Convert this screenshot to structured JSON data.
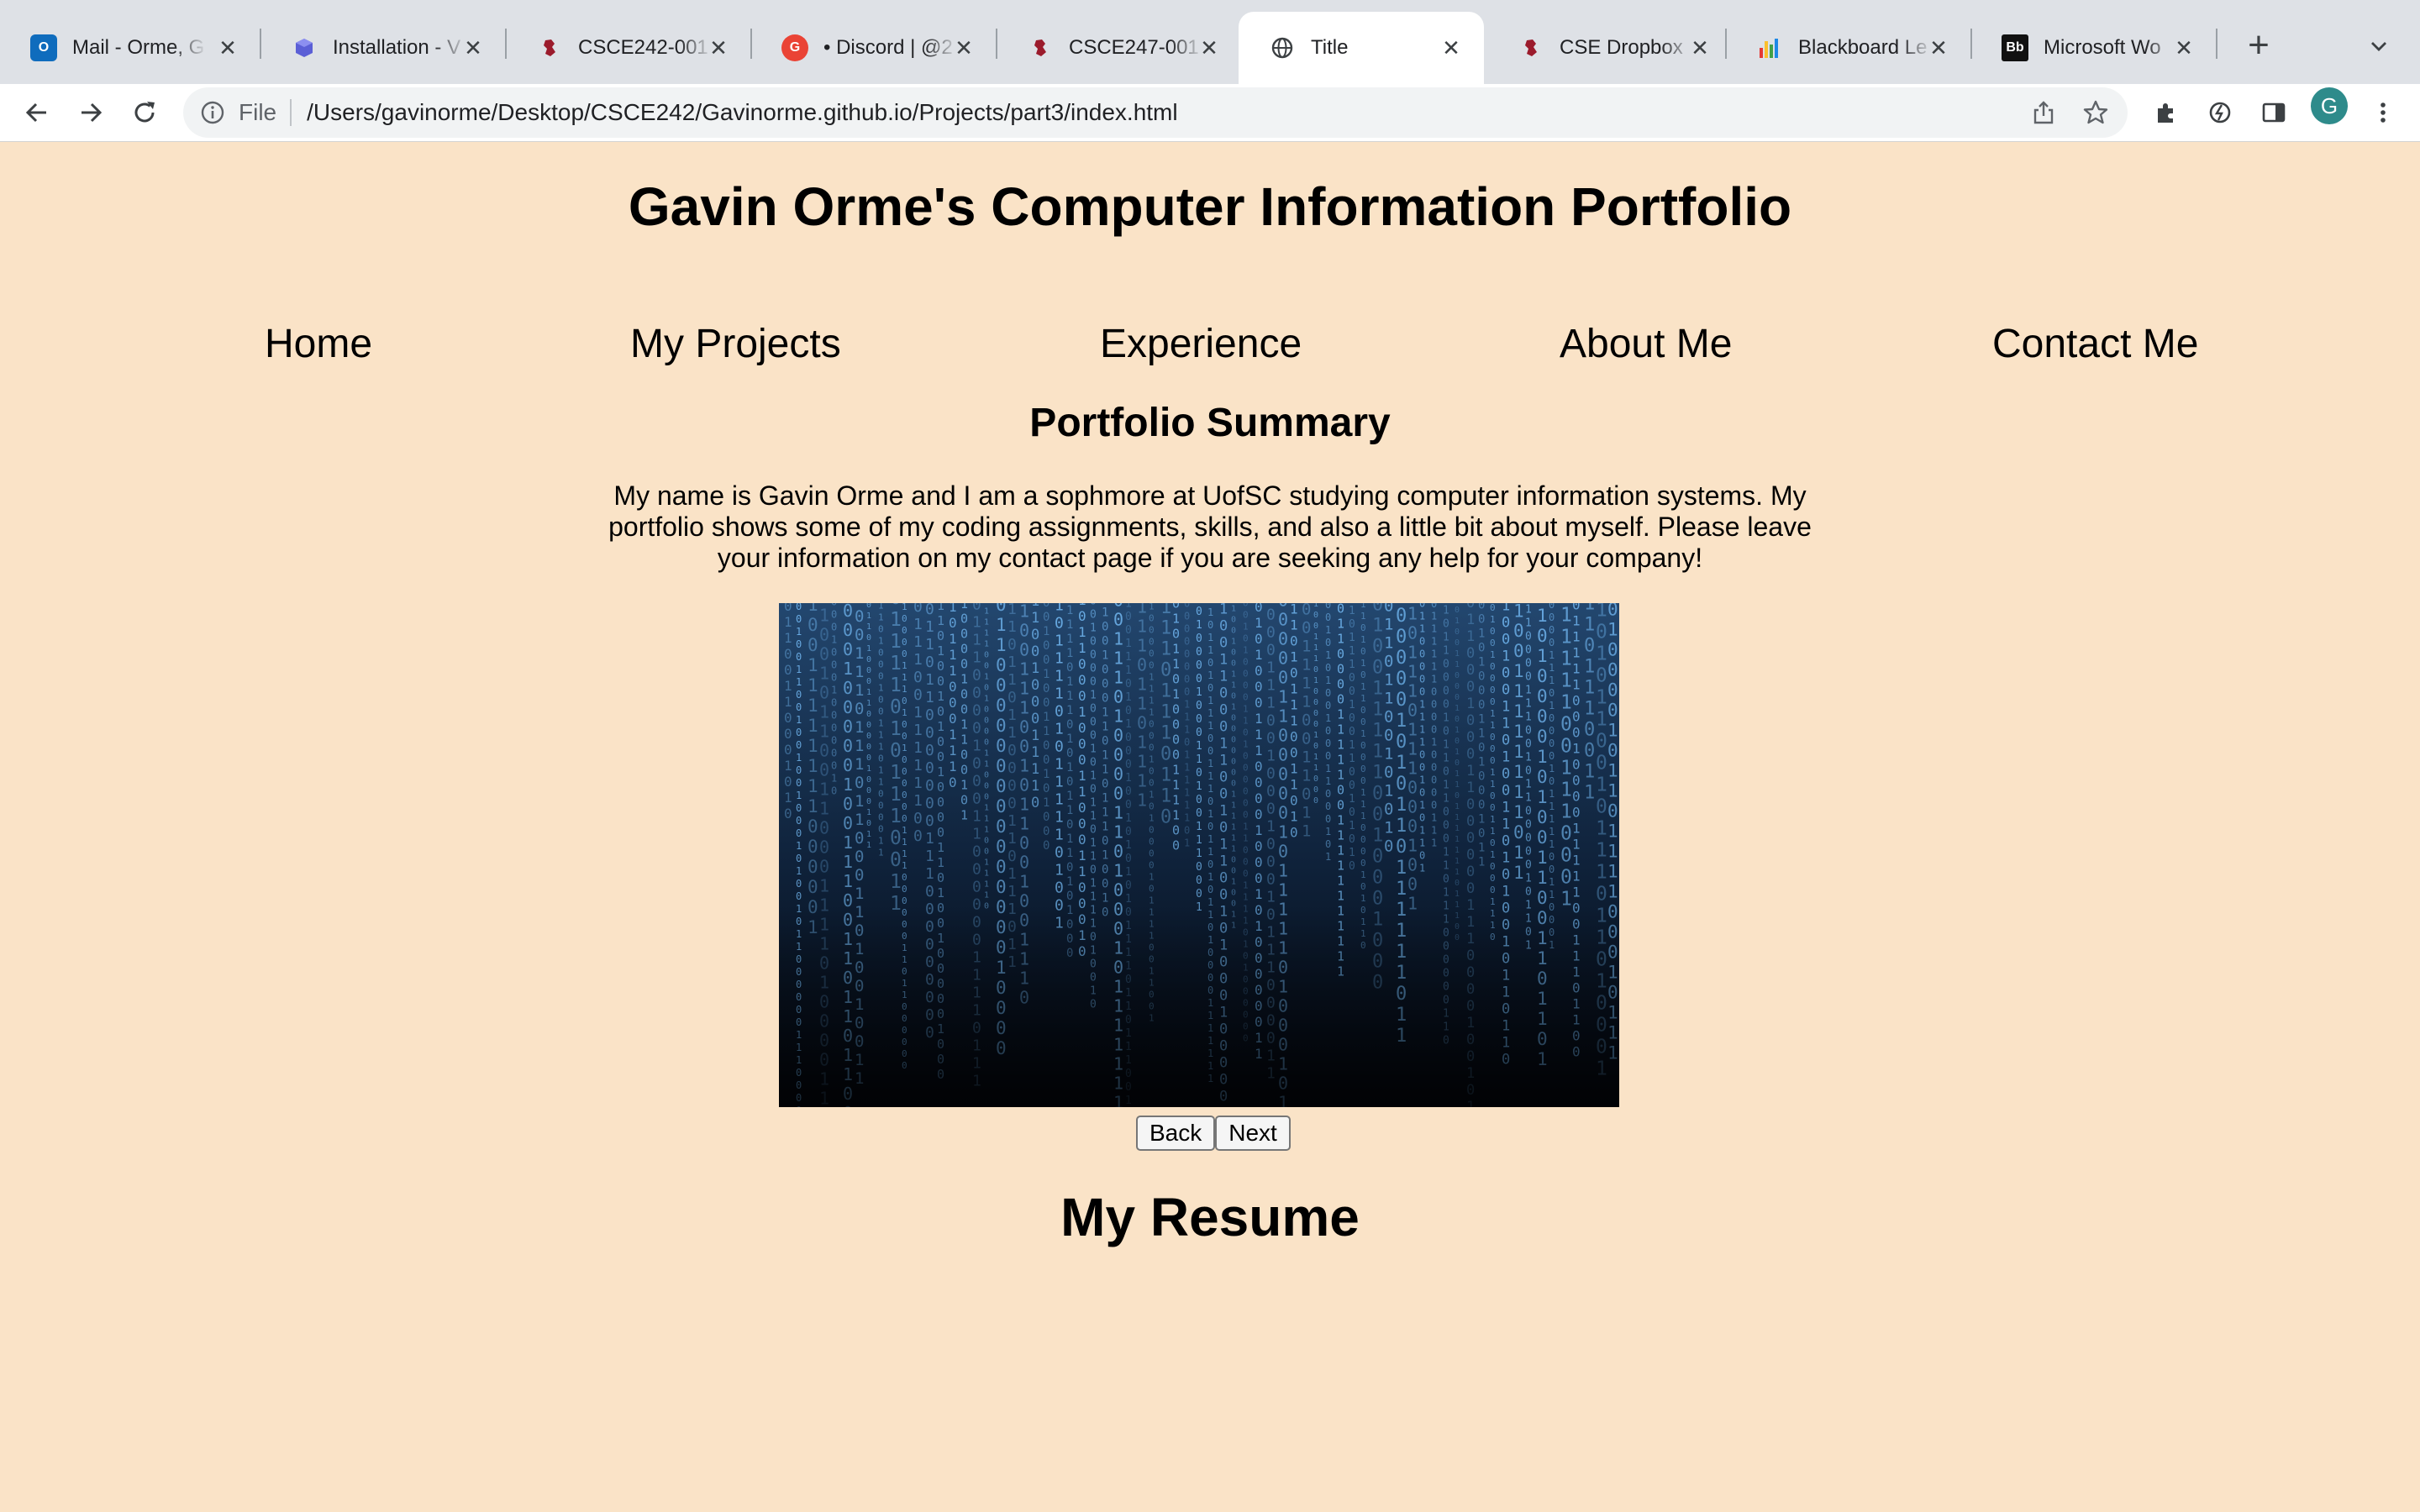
{
  "browser": {
    "tabs": [
      {
        "title": "Mail - Orme, G",
        "icon": "outlook-icon"
      },
      {
        "title": "Installation - V",
        "icon": "cube-icon"
      },
      {
        "title": "CSCE242-001",
        "icon": "gamecock-icon"
      },
      {
        "title": "• Discord | @2",
        "icon": "discord-icon"
      },
      {
        "title": "CSCE247-001",
        "icon": "gamecock-icon"
      },
      {
        "title": "Title",
        "icon": "globe-icon"
      },
      {
        "title": "CSE Dropbox",
        "icon": "gamecock-icon"
      },
      {
        "title": "Blackboard Le",
        "icon": "bar-chart-icon"
      },
      {
        "title": "Microsoft Wo",
        "icon": "blackboard-icon"
      }
    ],
    "active_tab": 5,
    "address": {
      "scheme": "File",
      "url": "/Users/gavinorme/Desktop/CSCE242/Gavinorme.github.io/Projects/part3/index.html"
    },
    "profile_initial": "G",
    "blackboard_badge": "Bb"
  },
  "page": {
    "title": "Gavin Orme's Computer Information Portfolio",
    "nav": [
      "Home",
      "My Projects",
      "Experience",
      "About Me",
      "Contact Me"
    ],
    "summary_heading": "Portfolio Summary",
    "summary_text": "My name is Gavin Orme and I am a sophmore at UofSC studying computer information systems. My portfolio shows some of my coding assignments, skills, and also a little bit about myself. Please leave your information on my contact page if you are seeking any help for your company!",
    "slideshow": {
      "back_label": "Back",
      "next_label": "Next"
    },
    "resume_heading": "My Resume"
  },
  "colors": {
    "page_background": "#fae3c7",
    "tabstrip": "#dee1e6",
    "binary_text": "#6fb4ee"
  }
}
